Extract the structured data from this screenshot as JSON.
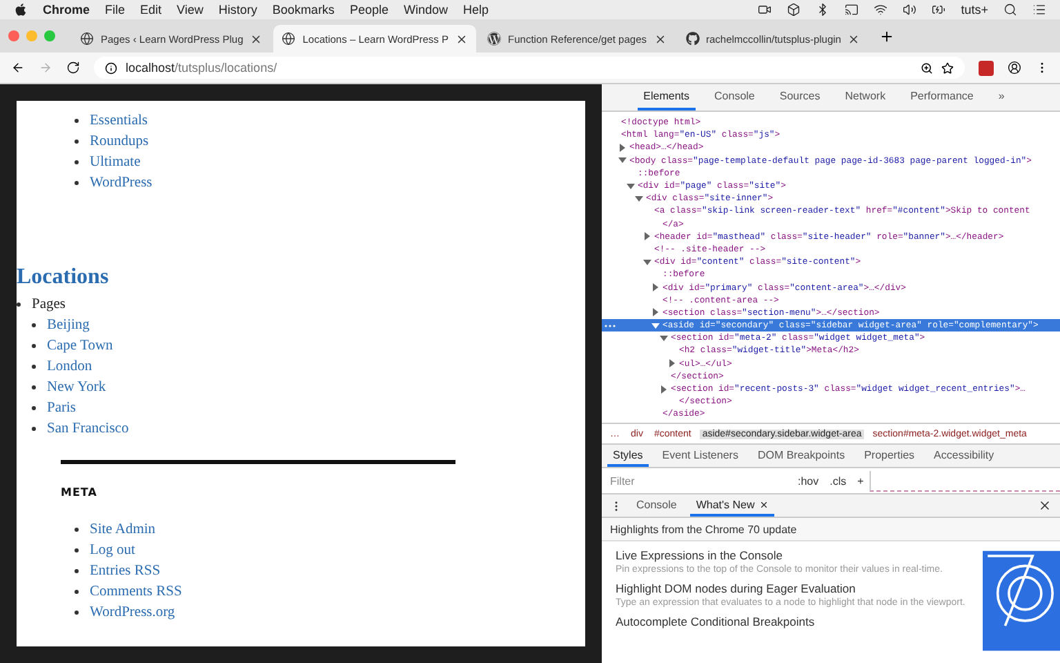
{
  "menu_bar": {
    "app": "Chrome",
    "items": [
      "File",
      "Edit",
      "View",
      "History",
      "Bookmarks",
      "People",
      "Window",
      "Help"
    ],
    "account": "tuts+"
  },
  "browser_tabs": [
    {
      "title": "Pages ‹ Learn WordPress Plug",
      "selected": false
    },
    {
      "title": "Locations – Learn WordPress P",
      "selected": true
    },
    {
      "title": "Function Reference/get pages",
      "selected": false
    },
    {
      "title": "rachelmccollin/tutsplus-plugin",
      "selected": false
    }
  ],
  "address_bar": {
    "host": "localhost",
    "path": "/tutsplus/locations/"
  },
  "page": {
    "category_links": [
      "Essentials",
      "Roundups",
      "Ultimate",
      "WordPress"
    ],
    "heading": "Locations",
    "pages_label": "Pages",
    "location_links": [
      "Beijing",
      "Cape Town",
      "London",
      "New York",
      "Paris",
      "San Francisco"
    ],
    "widget_title": "META",
    "meta_links": [
      "Site Admin",
      "Log out",
      "Entries RSS",
      "Comments RSS",
      "WordPress.org"
    ]
  },
  "devtools": {
    "tabs": [
      {
        "label": "Elements",
        "selected": true
      },
      {
        "label": "Console",
        "selected": false
      },
      {
        "label": "Sources",
        "selected": false
      },
      {
        "label": "Network",
        "selected": false
      },
      {
        "label": "Performance",
        "selected": false
      }
    ],
    "more_tabs": "»",
    "dom_tree": [
      {
        "text": "<!doctype html>",
        "selected": false
      },
      {
        "text": "<html lang=\"en-US\" class=\"js\">",
        "selected": false,
        "children": [
          {
            "text": "<head>…</head>",
            "expanded": false,
            "selected": false
          },
          {
            "text": "<body class=\"page-template-default page page-id-3683 page-parent logged-in\">",
            "expanded": true,
            "selected": false,
            "children": [
              {
                "text": "::before",
                "selected": false
              },
              {
                "text": "<div id=\"page\" class=\"site\">",
                "expanded": true,
                "selected": false,
                "children": [
                  {
                    "text": "<div class=\"site-inner\">",
                    "expanded": true,
                    "selected": false,
                    "children": [
                      {
                        "text": "<a class=\"skip-link screen-reader-text\" href=\"#content\">Skip to content",
                        "selected": false,
                        "close": "</a>"
                      },
                      {
                        "text": "<header id=\"masthead\" class=\"site-header\" role=\"banner\">…</header>",
                        "expanded": false,
                        "selected": false
                      },
                      {
                        "text": "<!-- .site-header -->",
                        "selected": false
                      },
                      {
                        "text": "<div id=\"content\" class=\"site-content\">",
                        "expanded": true,
                        "selected": false,
                        "children": [
                          {
                            "text": "::before",
                            "selected": false
                          },
                          {
                            "text": "<div id=\"primary\" class=\"content-area\">…</div>",
                            "expanded": false,
                            "selected": false
                          },
                          {
                            "text": "<!-- .content-area -->",
                            "selected": false
                          },
                          {
                            "text": "<section class=\"section-menu\">…</section>",
                            "expanded": false,
                            "selected": false
                          },
                          {
                            "text": "<aside id=\"secondary\" class=\"sidebar widget-area\" role=\"complementary\">",
                            "expanded": true,
                            "selected": true,
                            "close": "</aside>",
                            "children": [
                              {
                                "text": "<section id=\"meta-2\" class=\"widget widget_meta\">",
                                "expanded": true,
                                "selected": false,
                                "close": "</section>",
                                "children": [
                                  {
                                    "text": "<h2 class=\"widget-title\">Meta</h2>",
                                    "selected": false
                                  },
                                  {
                                    "text": "<ul>…</ul>",
                                    "expanded": false,
                                    "selected": false
                                  }
                                ]
                              },
                              {
                                "text": "<section id=\"recent-posts-3\" class=\"widget widget_recent_entries\">…",
                                "expanded": false,
                                "selected": false,
                                "close": "</section>"
                              }
                            ]
                          }
                        ]
                      }
                    ]
                  }
                ]
              }
            ]
          }
        ]
      }
    ],
    "breadcrumbs": [
      {
        "label": "…",
        "selected": false
      },
      {
        "label": "div",
        "selected": false
      },
      {
        "label": "#content",
        "selected": false
      },
      {
        "label": "aside#secondary.sidebar.widget-area",
        "selected": true
      },
      {
        "label": "section#meta-2.widget.widget_meta",
        "selected": false
      }
    ],
    "pane_tabs": [
      {
        "label": "Styles",
        "selected": true
      },
      {
        "label": "Event Listeners",
        "selected": false
      },
      {
        "label": "DOM Breakpoints",
        "selected": false
      },
      {
        "label": "Properties",
        "selected": false
      },
      {
        "label": "Accessibility",
        "selected": false
      }
    ],
    "filter": {
      "placeholder": "Filter",
      "hov": ":hov",
      "cls": ".cls",
      "add": "+"
    },
    "drawer_tabs": [
      {
        "label": "Console",
        "selected": false
      },
      {
        "label": "What's New",
        "selected": true
      }
    ],
    "drawer_heading": "Highlights from the Chrome 70 update",
    "news": [
      {
        "title": "Live Expressions in the Console",
        "description": "Pin expressions to the top of the Console to monitor their values in real-time."
      },
      {
        "title": "Highlight DOM nodes during Eager Evaluation",
        "description": "Type an expression that evaluates to a node to highlight that node in the viewport."
      },
      {
        "title": "Autocomplete Conditional Breakpoints"
      }
    ]
  }
}
